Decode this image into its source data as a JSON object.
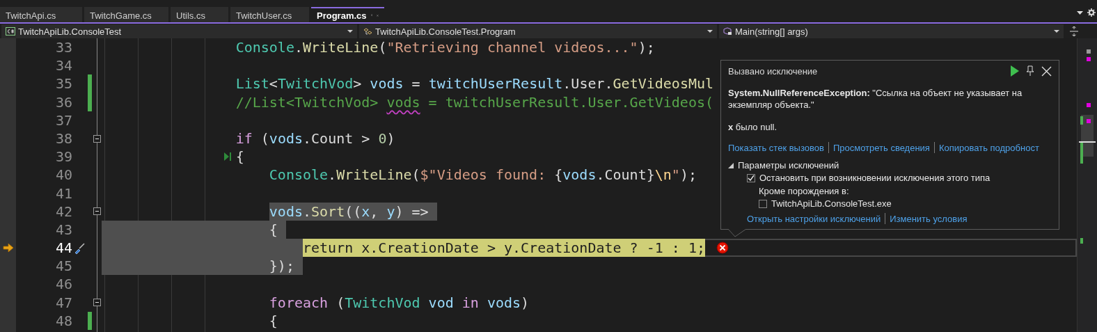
{
  "tabs": [
    {
      "label": "TwitchApi.cs",
      "selected": false
    },
    {
      "label": "TwitchGame.cs",
      "selected": false
    },
    {
      "label": "Utils.cs",
      "selected": false
    },
    {
      "label": "TwitchUser.cs",
      "selected": false
    },
    {
      "label": "Program.cs",
      "selected": true
    }
  ],
  "navigation_bar": {
    "project": "TwitchApiLib.ConsoleTest",
    "type": "TwitchApiLib.ConsoleTest.Program",
    "member": "Main(string[] args)"
  },
  "editor": {
    "lines": [
      {
        "number": "33",
        "changed": false,
        "foldable": false,
        "current": false,
        "selected": false,
        "step_glyph": false,
        "error": false,
        "tokens": [
          {
            "kind": "type",
            "t": "Console"
          },
          {
            "kind": "plain",
            "t": "."
          },
          {
            "kind": "method",
            "t": "WriteLine"
          },
          {
            "kind": "plain",
            "t": "("
          },
          {
            "kind": "string",
            "t": "\"Retrieving channel videos...\""
          },
          {
            "kind": "plain",
            "t": ");"
          }
        ]
      },
      {
        "number": "34",
        "changed": false,
        "foldable": false,
        "current": false,
        "selected": false,
        "step_glyph": false,
        "error": false
      },
      {
        "number": "35",
        "changed": true,
        "foldable": false,
        "current": false,
        "selected": false,
        "step_glyph": false,
        "error": false,
        "tokens": [
          {
            "kind": "type",
            "t": "List"
          },
          {
            "kind": "plain",
            "t": "<"
          },
          {
            "kind": "type",
            "t": "TwitchVod"
          },
          {
            "kind": "plain",
            "t": "> "
          },
          {
            "kind": "var",
            "t": "vods"
          },
          {
            "kind": "plain",
            "t": " = "
          },
          {
            "kind": "var",
            "t": "twitchUserResult"
          },
          {
            "kind": "plain",
            "t": ".User."
          },
          {
            "kind": "method",
            "t": "GetVideosMul"
          }
        ]
      },
      {
        "number": "36",
        "changed": true,
        "foldable": false,
        "current": false,
        "selected": false,
        "step_glyph": false,
        "error": false,
        "tokens": [
          {
            "kind": "comment",
            "t": "//List<TwitchVod> "
          },
          {
            "kind": "comment",
            "t": "vods",
            "squiggle": true
          },
          {
            "kind": "comment",
            "t": " = twitchUserResult.User.GetVideos("
          }
        ]
      },
      {
        "number": "37",
        "changed": false,
        "foldable": false,
        "current": false,
        "selected": false,
        "step_glyph": false,
        "error": false
      },
      {
        "number": "38",
        "changed": false,
        "foldable": true,
        "current": false,
        "selected": false,
        "step_glyph": false,
        "error": false,
        "tokens": [
          {
            "kind": "keyword",
            "t": "if"
          },
          {
            "kind": "plain",
            "t": " ("
          },
          {
            "kind": "var",
            "t": "vods"
          },
          {
            "kind": "plain",
            "t": ".Count > "
          },
          {
            "kind": "number",
            "t": "0"
          },
          {
            "kind": "plain",
            "t": ")"
          }
        ]
      },
      {
        "number": "39",
        "changed": false,
        "foldable": false,
        "current": false,
        "selected": false,
        "step_glyph": true,
        "error": false,
        "tokens": [
          {
            "kind": "plain",
            "t": "{"
          }
        ]
      },
      {
        "number": "40",
        "changed": false,
        "foldable": false,
        "current": false,
        "selected": false,
        "step_glyph": false,
        "error": false,
        "tokens": [
          {
            "kind": "type",
            "t": "Console"
          },
          {
            "kind": "plain",
            "t": "."
          },
          {
            "kind": "method",
            "t": "WriteLine"
          },
          {
            "kind": "plain",
            "t": "("
          },
          {
            "kind": "string",
            "t": "$\"Videos found: "
          },
          {
            "kind": "plain",
            "t": "{"
          },
          {
            "kind": "var",
            "t": "vods"
          },
          {
            "kind": "plain",
            "t": ".Count}"
          },
          {
            "kind": "escape",
            "t": "\\n"
          },
          {
            "kind": "string",
            "t": "\""
          },
          {
            "kind": "plain",
            "t": ");"
          }
        ]
      },
      {
        "number": "41",
        "changed": false,
        "foldable": false,
        "current": false,
        "selected": false,
        "step_glyph": false,
        "error": false
      },
      {
        "number": "42",
        "changed": false,
        "foldable": true,
        "current": false,
        "selected": true,
        "step_glyph": false,
        "error": false,
        "tokens": [
          {
            "kind": "var",
            "t": "vods"
          },
          {
            "kind": "plain",
            "t": "."
          },
          {
            "kind": "method",
            "t": "Sort"
          },
          {
            "kind": "plain",
            "t": "(("
          },
          {
            "kind": "var",
            "t": "x"
          },
          {
            "kind": "plain",
            "t": ", "
          },
          {
            "kind": "var",
            "t": "y"
          },
          {
            "kind": "plain",
            "t": ") =>"
          }
        ]
      },
      {
        "number": "43",
        "changed": false,
        "foldable": false,
        "current": false,
        "selected": true,
        "step_glyph": false,
        "error": false,
        "tokens": [
          {
            "kind": "plain",
            "t": "{"
          }
        ]
      },
      {
        "number": "44",
        "changed": false,
        "foldable": false,
        "current": true,
        "selected": true,
        "step_glyph": false,
        "error": true,
        "tokens": [
          {
            "kind": "keyword",
            "t": "return"
          },
          {
            "kind": "plain",
            "t": " x.CreationDate > y.CreationDate ? -1 : 1;"
          }
        ]
      },
      {
        "number": "45",
        "changed": false,
        "foldable": false,
        "current": false,
        "selected": true,
        "step_glyph": false,
        "error": false,
        "tokens": [
          {
            "kind": "plain",
            "t": "});"
          }
        ]
      },
      {
        "number": "46",
        "changed": false,
        "foldable": false,
        "current": false,
        "selected": false,
        "step_glyph": false,
        "error": false
      },
      {
        "number": "47",
        "changed": false,
        "foldable": true,
        "current": false,
        "selected": false,
        "step_glyph": false,
        "error": false,
        "tokens": [
          {
            "kind": "keyword",
            "t": "foreach"
          },
          {
            "kind": "plain",
            "t": " ("
          },
          {
            "kind": "type",
            "t": "TwitchVod"
          },
          {
            "kind": "var",
            "t": " vod "
          },
          {
            "kind": "keyword",
            "t": "in"
          },
          {
            "kind": "var",
            "t": " vods"
          },
          {
            "kind": "plain",
            "t": ")"
          }
        ]
      },
      {
        "number": "48",
        "changed": true,
        "foldable": false,
        "current": false,
        "selected": false,
        "step_glyph": false,
        "error": false,
        "tokens": [
          {
            "kind": "plain",
            "t": "{"
          }
        ]
      }
    ]
  },
  "exception_popup": {
    "title": "Вызвано исключение",
    "message": "**System.NullReferenceException:** \"Ссылка на объект не указывает на экземпляр объекта.\"",
    "detail": "**x** было null.",
    "links": [
      "Показать стек вызовов",
      "Просмотреть сведения",
      "Копировать подробност"
    ],
    "settings": {
      "label": "Параметры исключений",
      "expanded": true,
      "break_option": {
        "label": "Остановить при возникновении исключения этого типа",
        "checked": true
      },
      "except_label": "Кроме порождения в:",
      "modules": [
        {
          "label": "TwitchApiLib.ConsoleTest.exe",
          "checked": false
        }
      ]
    },
    "footer_links": [
      "Открыть настройки исключений",
      "Изменить условия"
    ]
  }
}
